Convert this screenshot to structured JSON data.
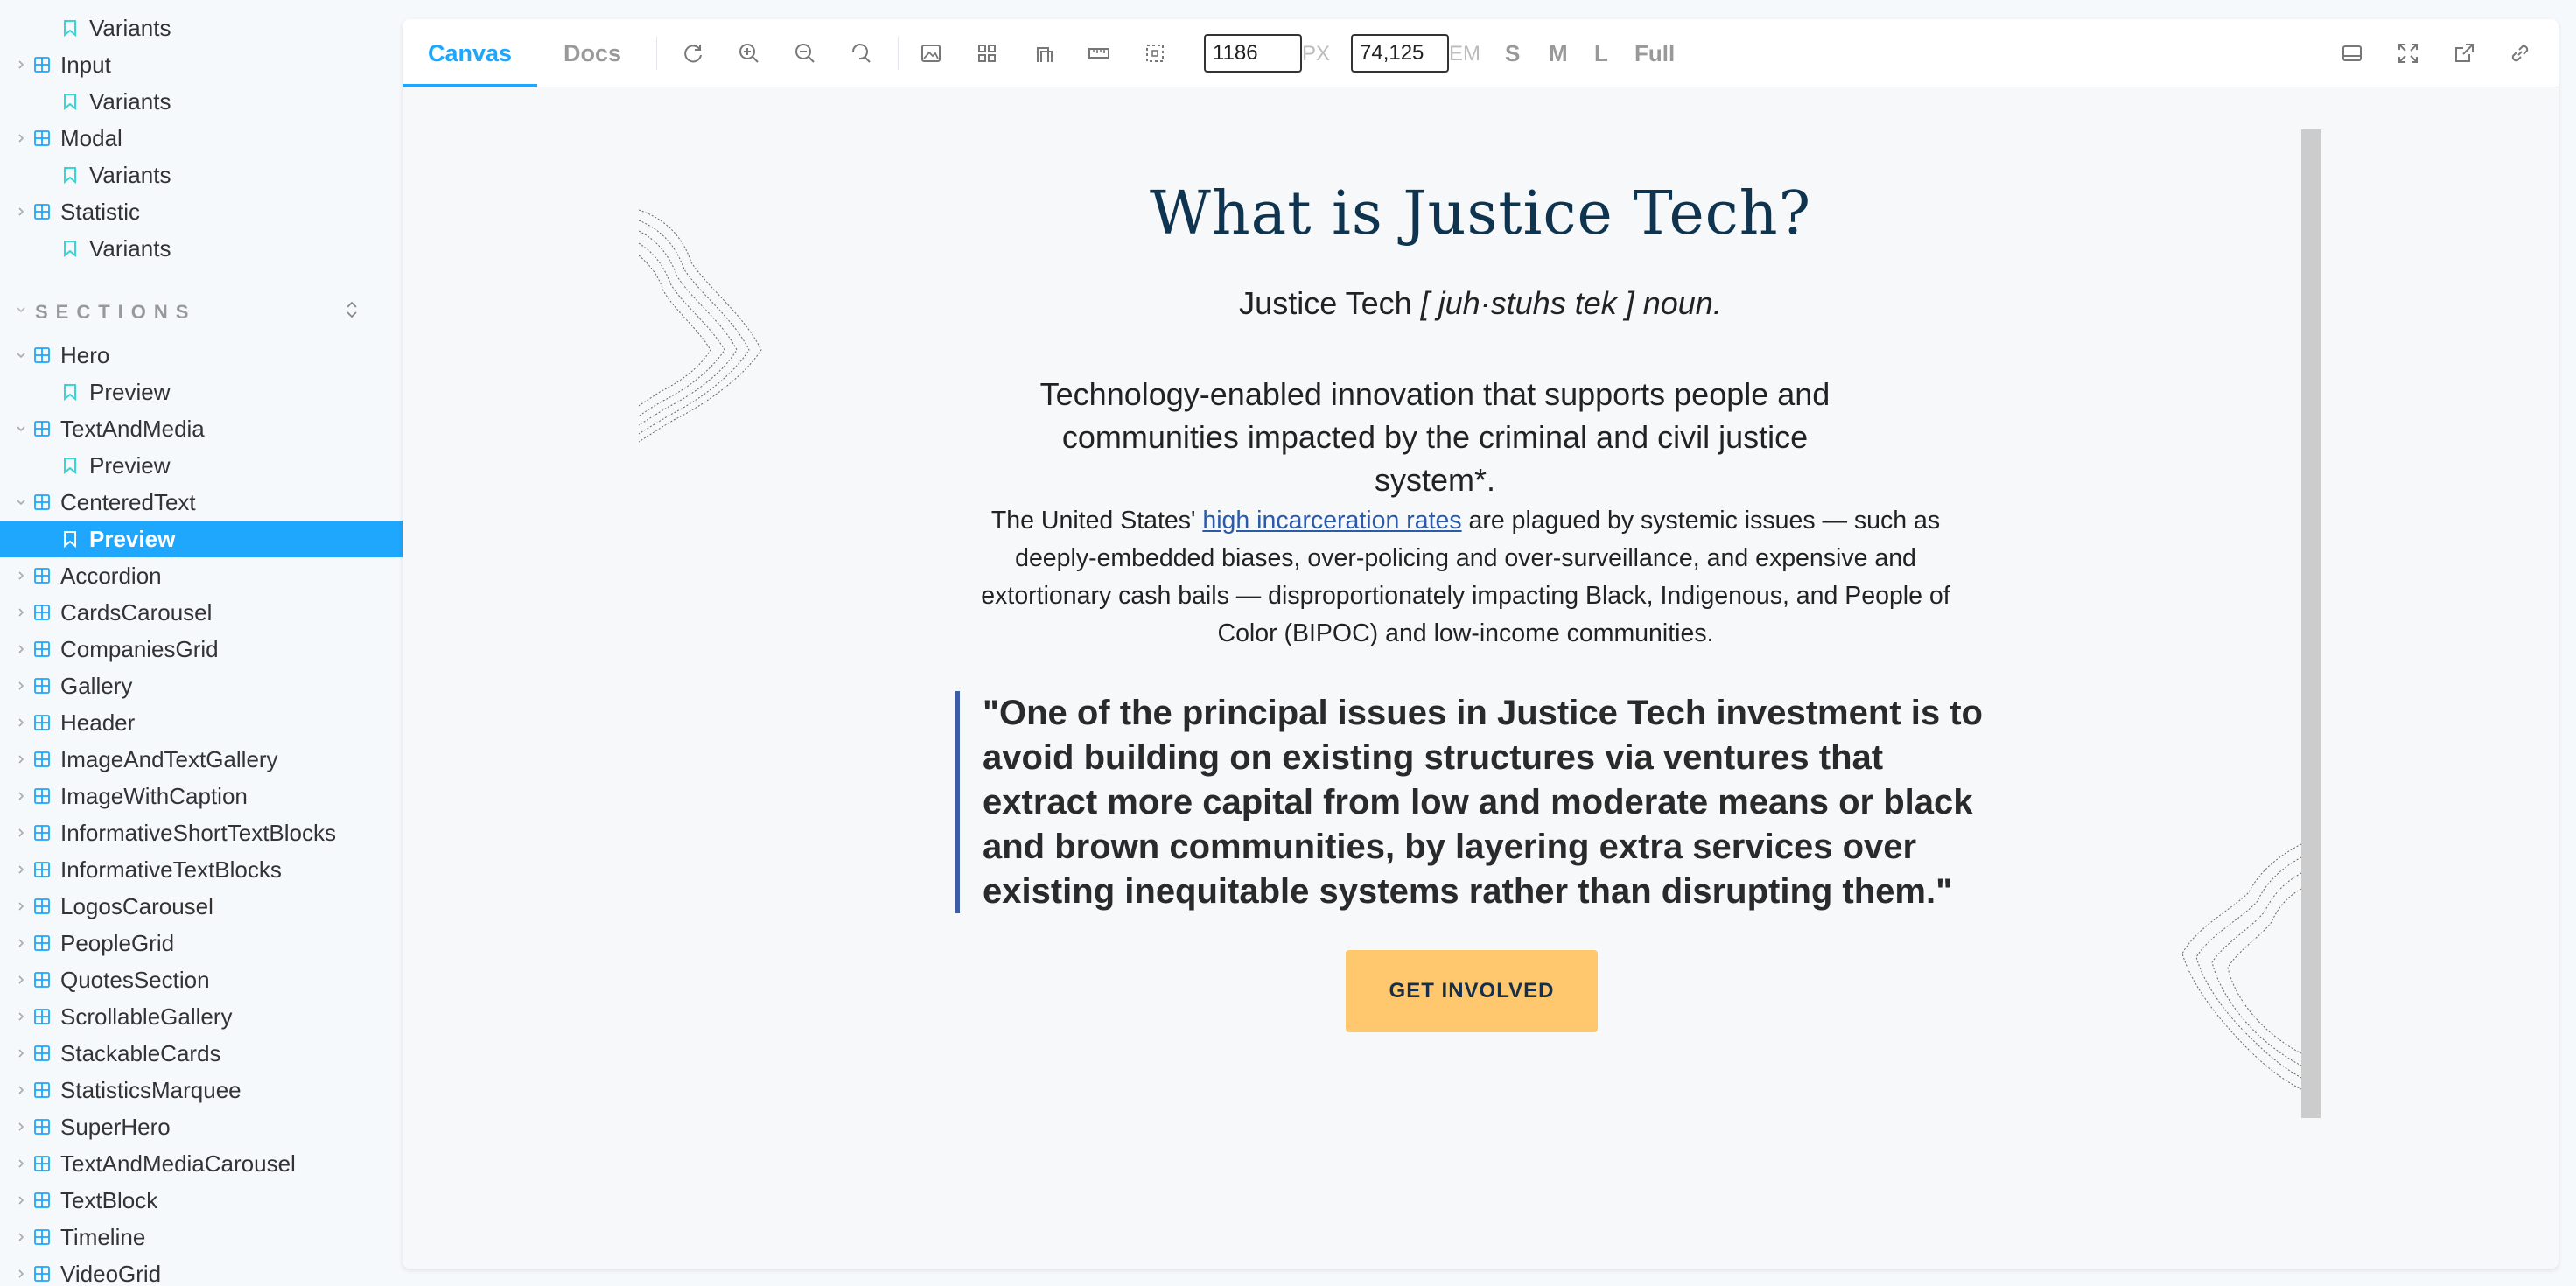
{
  "sidebar": {
    "top_items": [
      {
        "kind": "story",
        "label": "Variants"
      },
      {
        "kind": "component",
        "label": "Input"
      },
      {
        "kind": "story",
        "label": "Variants"
      },
      {
        "kind": "component",
        "label": "Modal"
      },
      {
        "kind": "story",
        "label": "Variants"
      },
      {
        "kind": "component",
        "label": "Statistic"
      },
      {
        "kind": "story",
        "label": "Variants"
      }
    ],
    "section_label": "SECTIONS",
    "section_items": [
      {
        "kind": "component",
        "label": "Hero",
        "expanded": true
      },
      {
        "kind": "story",
        "label": "Preview"
      },
      {
        "kind": "component",
        "label": "TextAndMedia",
        "expanded": true
      },
      {
        "kind": "story",
        "label": "Preview"
      },
      {
        "kind": "component",
        "label": "CenteredText",
        "expanded": true
      },
      {
        "kind": "story",
        "label": "Preview",
        "selected": true
      },
      {
        "kind": "component",
        "label": "Accordion"
      },
      {
        "kind": "component",
        "label": "CardsCarousel"
      },
      {
        "kind": "component",
        "label": "CompaniesGrid"
      },
      {
        "kind": "component",
        "label": "Gallery"
      },
      {
        "kind": "component",
        "label": "Header"
      },
      {
        "kind": "component",
        "label": "ImageAndTextGallery"
      },
      {
        "kind": "component",
        "label": "ImageWithCaption"
      },
      {
        "kind": "component",
        "label": "InformativeShortTextBlocks"
      },
      {
        "kind": "component",
        "label": "InformativeTextBlocks"
      },
      {
        "kind": "component",
        "label": "LogosCarousel"
      },
      {
        "kind": "component",
        "label": "PeopleGrid"
      },
      {
        "kind": "component",
        "label": "QuotesSection"
      },
      {
        "kind": "component",
        "label": "ScrollableGallery"
      },
      {
        "kind": "component",
        "label": "StackableCards"
      },
      {
        "kind": "component",
        "label": "StatisticsMarquee"
      },
      {
        "kind": "component",
        "label": "SuperHero"
      },
      {
        "kind": "component",
        "label": "TextAndMediaCarousel"
      },
      {
        "kind": "component",
        "label": "TextBlock"
      },
      {
        "kind": "component",
        "label": "Timeline"
      },
      {
        "kind": "component",
        "label": "VideoGrid"
      }
    ]
  },
  "toolbar": {
    "tab_canvas": "Canvas",
    "tab_docs": "Docs",
    "px_value": "1186",
    "px_unit": "PX",
    "em_value": "74,125",
    "em_unit": "EM",
    "size_s": "S",
    "size_m": "M",
    "size_l": "L",
    "size_full": "Full"
  },
  "story": {
    "title": "What is Justice Tech?",
    "definition_term": "Justice Tech",
    "definition_pron": "[ juh·stuhs tek ] noun.",
    "tagline": "Technology-enabled innovation that supports people and communities impacted by the criminal and civil justice system*.",
    "body_before": "The United States' ",
    "body_link": "high incarceration rates",
    "body_after": " are plagued by systemic issues — such as deeply-embedded biases, over-policing and over-surveillance, and expensive and extortionary cash bails — disproportionately impacting Black, Indigenous, and People of Color (BIPOC) and low-income communities.",
    "quote": "\"One of the principal issues in Justice Tech investment is to avoid building on existing structures via ventures that extract more capital from low and moderate means or black and brown communities, by layering extra services over existing inequitable systems rather than disrupting them.\"",
    "cta": "GET INVOLVED"
  },
  "colors": {
    "accent": "#1ea7fd",
    "title": "#0e3450",
    "link": "#2b5aa8",
    "quote_bar": "#3d5ca8",
    "cta_bg": "#ffc76e"
  }
}
